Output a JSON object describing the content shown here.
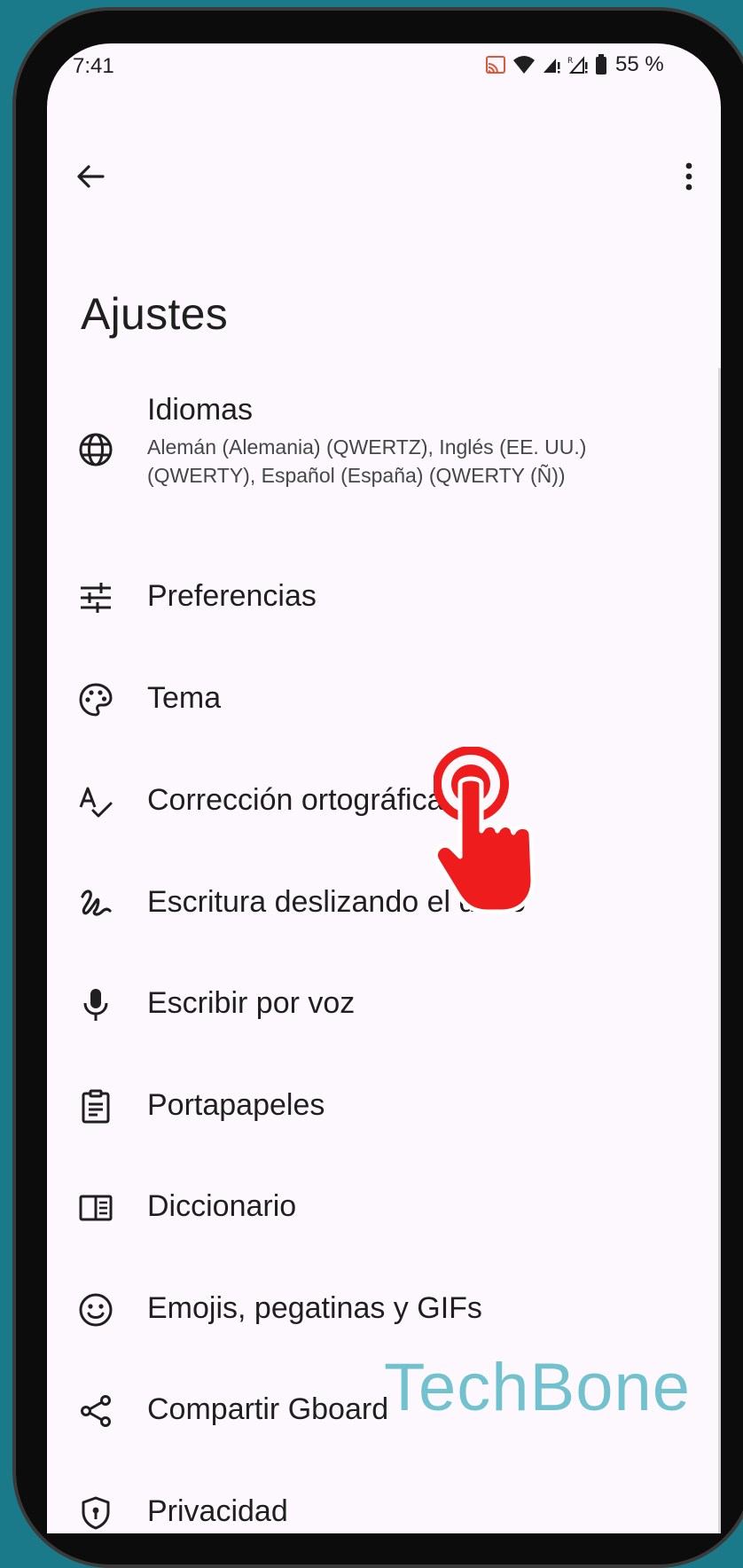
{
  "status_bar": {
    "time": "7:41",
    "battery": "55 %",
    "icons": [
      "cast-icon",
      "wifi-icon",
      "signal-icon",
      "signal-roaming-icon",
      "battery-icon"
    ]
  },
  "top_bar": {
    "back_icon": "arrow-back-icon",
    "menu_icon": "more-vert-icon"
  },
  "page": {
    "title": "Ajustes"
  },
  "settings": {
    "items": [
      {
        "label": "Idiomas",
        "summary": "Alemán (Alemania) (QWERTZ), Inglés (EE. UU.) (QWERTY), Español (España) (QWERTY (Ñ))",
        "icon": "globe-icon"
      },
      {
        "label": "Preferencias",
        "icon": "tune-icon"
      },
      {
        "label": "Tema",
        "icon": "palette-icon"
      },
      {
        "label": "Corrección ortográfica",
        "icon": "spellcheck-icon"
      },
      {
        "label": "Escritura deslizando el dedo",
        "icon": "gesture-icon"
      },
      {
        "label": "Escribir por voz",
        "icon": "mic-icon"
      },
      {
        "label": "Portapapeles",
        "icon": "clipboard-icon"
      },
      {
        "label": "Diccionario",
        "icon": "dictionary-icon"
      },
      {
        "label": "Emojis, pegatinas y GIFs",
        "icon": "emoji-icon"
      },
      {
        "label": "Compartir Gboard",
        "icon": "share-icon"
      },
      {
        "label": "Privacidad",
        "icon": "shield-icon"
      }
    ]
  },
  "overlay": {
    "watermark": "TechBone",
    "tap_color": "#ee1c1c"
  }
}
